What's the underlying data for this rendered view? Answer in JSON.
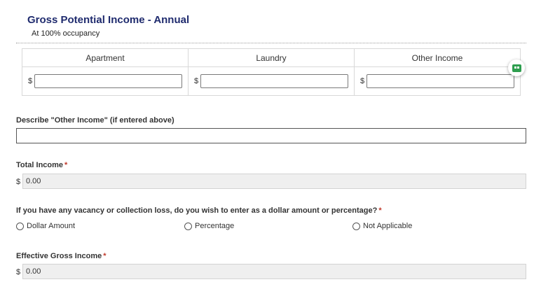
{
  "section": {
    "title": "Gross Potential Income - Annual",
    "subtitle": "At 100% occupancy"
  },
  "income_table": {
    "columns": [
      {
        "header": "Apartment",
        "prefix": "$",
        "value": ""
      },
      {
        "header": "Laundry",
        "prefix": "$",
        "value": ""
      },
      {
        "header": "Other Income",
        "prefix": "$",
        "value": ""
      }
    ]
  },
  "floating_button": {
    "icon": "grammarly-style-assistant-icon",
    "color": "#2e9e4f"
  },
  "other_income_desc": {
    "label": "Describe \"Other Income\" (if entered above)",
    "value": ""
  },
  "total_income": {
    "label": "Total Income",
    "required_mark": "*",
    "prefix": "$",
    "value": "0.00"
  },
  "vacancy_question": {
    "label": "If you have any vacancy or collection loss, do you wish to enter as a dollar amount or percentage?",
    "required_mark": "*",
    "options": [
      "Dollar Amount",
      "Percentage",
      "Not Applicable"
    ],
    "selected": null
  },
  "effective_gross_income": {
    "label": "Effective Gross Income",
    "required_mark": "*",
    "prefix": "$",
    "value": "0.00"
  },
  "colors": {
    "title": "#1f2b6e",
    "required": "#c0392b",
    "readonly_bg": "#efefef"
  }
}
